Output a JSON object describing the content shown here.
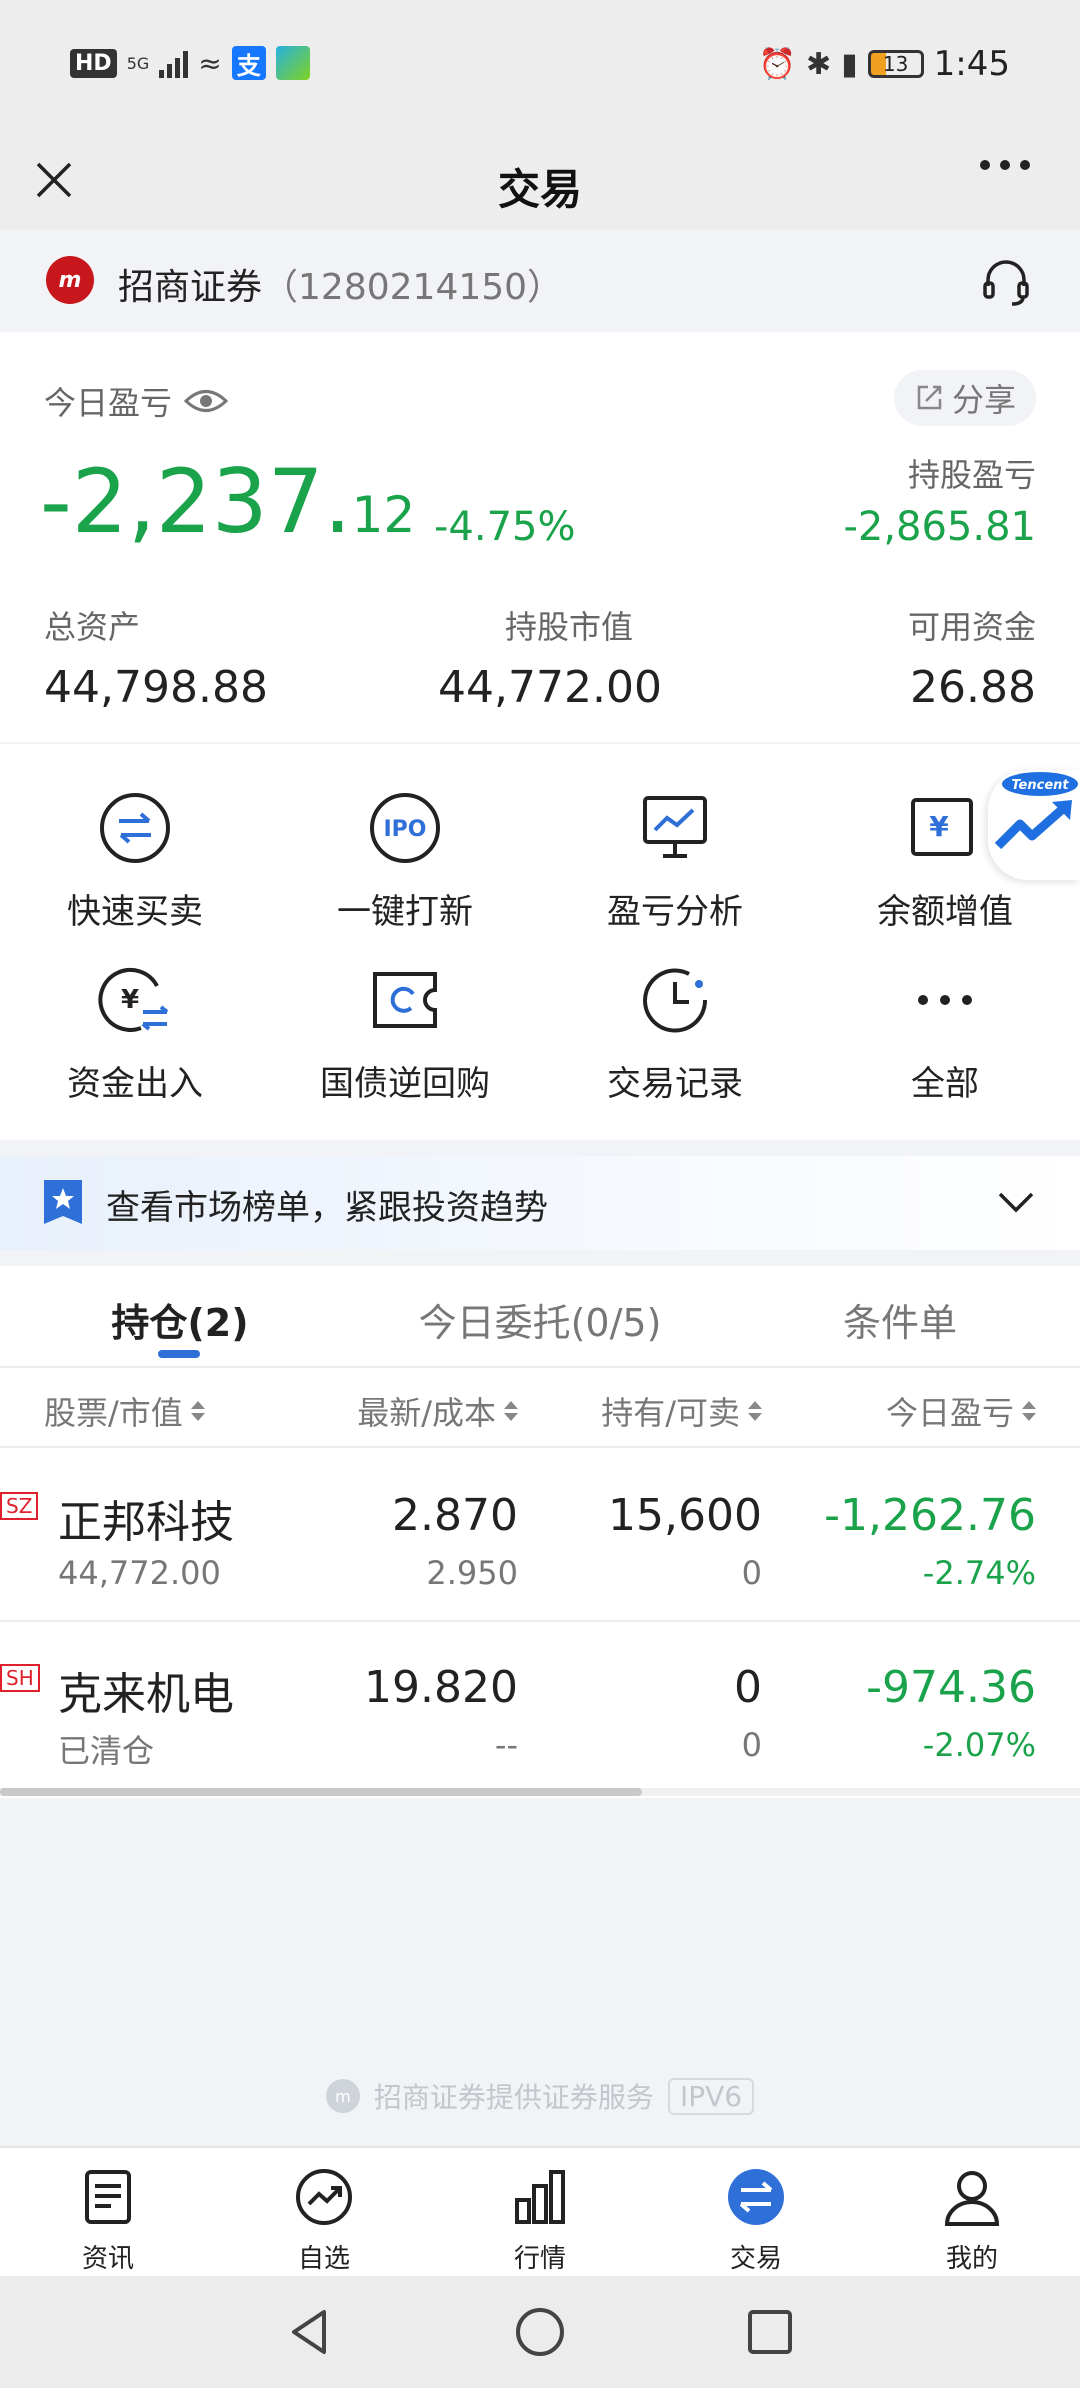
{
  "status_bar": {
    "hd": "HD",
    "network": "5G",
    "app_icon_1": "支",
    "battery": "13",
    "time": "1:45"
  },
  "title_bar": {
    "title": "交易"
  },
  "broker": {
    "name": "招商证券",
    "account": "（1280214150）",
    "logo_text": "m"
  },
  "summary": {
    "today_pl_label": "今日盈亏",
    "share_label": "分享",
    "today_pl_int": "-2,237.",
    "today_pl_dec": "12",
    "today_pl_pct": "-4.75%",
    "holding_pl_label": "持股盈亏",
    "holding_pl_value": "-2,865.81",
    "total_assets_label": "总资产",
    "total_assets_value": "44,798.88",
    "market_value_label": "持股市值",
    "market_value_value": "44,772.00",
    "available_funds_label": "可用资金",
    "available_funds_value": "26.88"
  },
  "functions": [
    {
      "label": "快速买卖",
      "icon": "quick-trade-icon"
    },
    {
      "label": "一键打新",
      "icon": "ipo-icon",
      "icon_text": "IPO"
    },
    {
      "label": "盈亏分析",
      "icon": "pl-analysis-icon"
    },
    {
      "label": "余额增值",
      "icon": "balance-growth-icon"
    },
    {
      "label": "资金出入",
      "icon": "funds-transfer-icon"
    },
    {
      "label": "国债逆回购",
      "icon": "reverse-repo-icon"
    },
    {
      "label": "交易记录",
      "icon": "clock-icon"
    },
    {
      "label": "全部",
      "icon": "more-icon"
    }
  ],
  "tencent_badge": "Tencent",
  "banner": {
    "text": "查看市场榜单，紧跟投资趋势"
  },
  "positions": {
    "tabs": [
      "持仓(2)",
      "今日委托(0/5)",
      "条件单"
    ],
    "active_tab": 0,
    "headers": [
      "股票/市值",
      "最新/成本",
      "持有/可卖",
      "今日盈亏"
    ],
    "rows": [
      {
        "exchange": "SZ",
        "name": "正邦科技",
        "market_value": "44,772.00",
        "latest": "2.870",
        "cost": "2.950",
        "holding": "15,600",
        "sellable": "0",
        "today_pl": "-1,262.76",
        "today_pct": "-2.74%"
      },
      {
        "exchange": "SH",
        "name": "克来机电",
        "market_value": "已清仓",
        "latest": "19.820",
        "cost": "--",
        "holding": "0",
        "sellable": "0",
        "today_pl": "-974.36",
        "today_pct": "-2.07%"
      }
    ]
  },
  "footer": {
    "note": "招商证券提供证券服务",
    "ipv6": "IPV6"
  },
  "tab_bar": [
    {
      "label": "资讯",
      "icon": "news-icon"
    },
    {
      "label": "自选",
      "icon": "watchlist-icon"
    },
    {
      "label": "行情",
      "icon": "market-icon"
    },
    {
      "label": "交易",
      "icon": "trade-icon",
      "active": true
    },
    {
      "label": "我的",
      "icon": "profile-icon"
    }
  ],
  "colors": {
    "loss_green": "#1aa34a",
    "accent_blue": "#2f6fd8",
    "exchange_red": "#e0202a",
    "broker_red": "#c8161d"
  }
}
